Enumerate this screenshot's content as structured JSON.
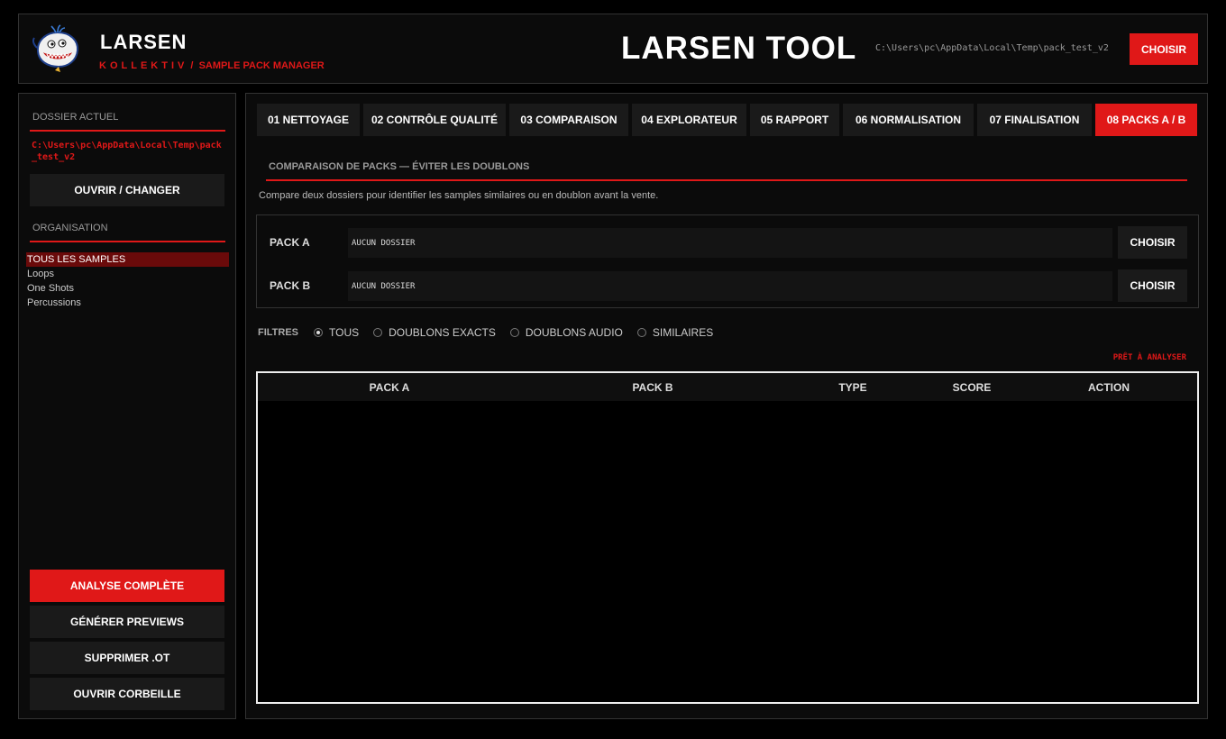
{
  "header": {
    "brand_title": "LARSEN",
    "brand_sub_kollektiv": "KOLLEKTIV",
    "brand_sub_sep": "/",
    "brand_sub_manager": "SAMPLE PACK MANAGER",
    "app_title": "LARSEN TOOL",
    "path": "C:\\Users\\pc\\AppData\\Local\\Temp\\pack_test_v2",
    "choose_label": "CHOISIR",
    "logo_icon": "whale-mascot-icon"
  },
  "sidebar": {
    "current_folder_label": "DOSSIER ACTUEL",
    "current_folder_path": "C:\\Users\\pc\\AppData\\Local\\Temp\\pack_test_v2",
    "open_change_label": "OUVRIR / CHANGER",
    "organisation_label": "ORGANISATION",
    "org_items": [
      "TOUS LES SAMPLES",
      "Loops",
      "One Shots",
      "Percussions"
    ],
    "actions": {
      "full_analysis": "ANALYSE COMPLÈTE",
      "generate_previews": "GÉNÉRER PREVIEWS",
      "delete_ot": "SUPPRIMER .OT",
      "open_trash": "OUVRIR CORBEILLE"
    }
  },
  "tabs": [
    "01 NETTOYAGE",
    "02 CONTRÔLE QUALITÉ",
    "03 COMPARAISON",
    "04 EXPLORATEUR",
    "05 RAPPORT",
    "06 NORMALISATION",
    "07 FINALISATION",
    "08 PACKS A / B"
  ],
  "main": {
    "section_title": "COMPARAISON DE PACKS — ÉVITER LES DOUBLONS",
    "description": "Compare deux dossiers pour identifier les samples similaires ou en doublon avant la vente.",
    "pack_a": {
      "label": "PACK A",
      "value": "AUCUN DOSSIER",
      "choose": "CHOISIR"
    },
    "pack_b": {
      "label": "PACK B",
      "value": "AUCUN DOSSIER",
      "choose": "CHOISIR"
    },
    "filters": {
      "label": "FILTRES",
      "options": [
        "TOUS",
        "DOUBLONS EXACTS",
        "DOUBLONS AUDIO",
        "SIMILAIRES"
      ],
      "selected": "TOUS"
    },
    "status": "PRÊT À ANALYSER",
    "table_headers": [
      "PACK A",
      "PACK B",
      "TYPE",
      "SCORE",
      "ACTION"
    ]
  },
  "colors": {
    "accent": "#e01818",
    "background": "#000000",
    "panel": "#0b0b0b",
    "button": "#1a1a1a",
    "selection": "#6a0a0a"
  }
}
